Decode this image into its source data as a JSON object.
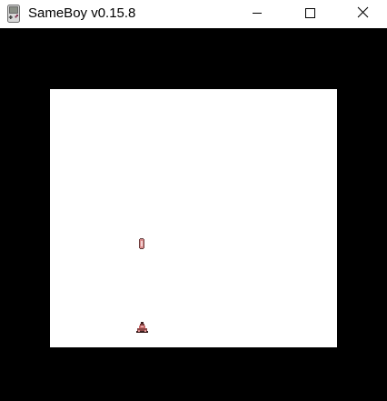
{
  "window": {
    "title": "SameBoy v0.15.8",
    "app_icon": "gameboy-icon",
    "controls": {
      "minimize_icon": "minimize-icon",
      "maximize_icon": "maximize-icon",
      "close_icon": "close-icon"
    }
  },
  "emulator": {
    "screen_color": "#ffffff",
    "border_color": "#000000",
    "sprites": [
      {
        "name": "upper-sprite",
        "icon": "capsule-sprite"
      },
      {
        "name": "lower-sprite",
        "icon": "ship-sprite"
      }
    ]
  }
}
